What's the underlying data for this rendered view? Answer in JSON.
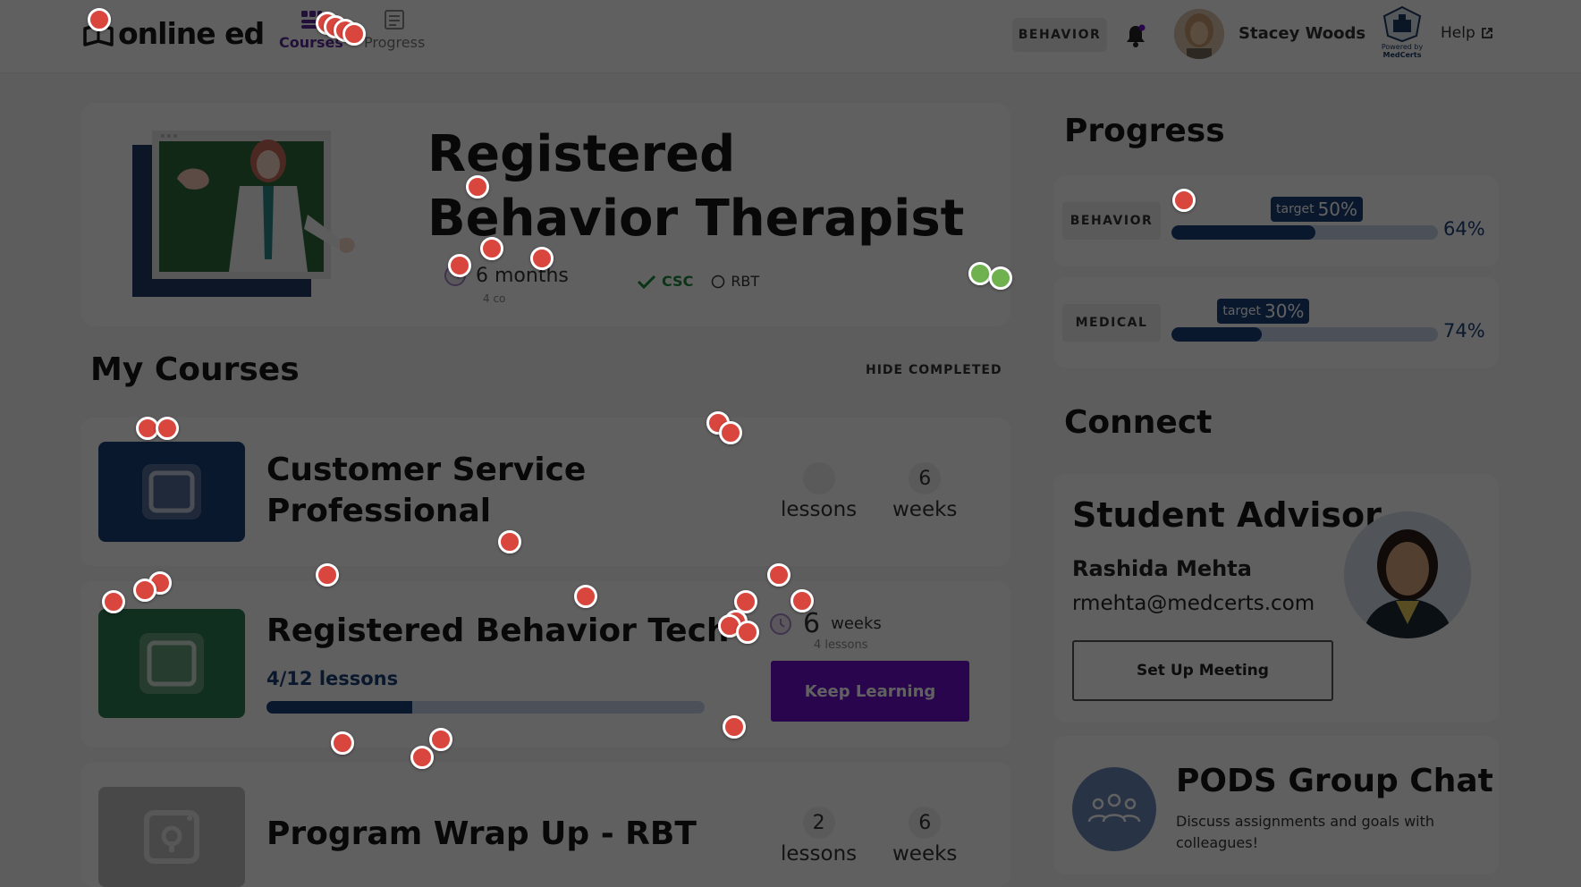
{
  "header": {
    "logo_text": "online ed",
    "nav": [
      {
        "label": "Courses",
        "icon": "courses-icon"
      },
      {
        "label": "Progress",
        "icon": "progress-icon"
      }
    ],
    "program_pill": "BEHAVIOR",
    "user_name": "Stacey Woods",
    "medcerts_line1": "Powered by",
    "medcerts_line2": "MedCerts",
    "help_label": "Help"
  },
  "hero": {
    "title": "Registered Behavior Therapist",
    "duration": "6 months",
    "duration_sub": "4 co",
    "tags": [
      {
        "label": "CSC",
        "state": "done"
      },
      {
        "label": "RBT",
        "state": "pending"
      }
    ]
  },
  "my_courses": {
    "title": "My Courses",
    "hide_completed": "HIDE COMPLETED",
    "courses": [
      {
        "title_line1": "Customer Service",
        "title_line2": "Professional",
        "lessons_num": "",
        "lessons_label": "lessons",
        "weeks_num": "6",
        "weeks_label": "weeks",
        "thumb_color": "#1c3f79"
      },
      {
        "title": "Registered Behavior Tech",
        "progress_text": "4/12 lessons",
        "progress_fraction": 0.3333,
        "duration_num": "6",
        "duration_unit": "weeks",
        "duration_sub": "4 lessons",
        "button_label": "Keep Learning",
        "thumb_color": "#2e7d4f"
      },
      {
        "title": "Program Wrap Up - RBT",
        "lessons_num": "2",
        "lessons_label": "lessons",
        "weeks_num": "6",
        "weeks_label": "weeks",
        "thumb_color": "#bbbbbb"
      }
    ]
  },
  "progress": {
    "title": "Progress",
    "items": [
      {
        "label": "BEHAVIOR",
        "target_label": "target",
        "target_value": "50%",
        "target_fraction": 0.5,
        "value_fraction": 0.64,
        "percent_text": "64%"
      },
      {
        "label": "MEDICAL",
        "target_label": "target",
        "target_value": "30%",
        "target_fraction": 0.3,
        "value_fraction": 0.74,
        "percent_text": "74%"
      }
    ]
  },
  "connect": {
    "title": "Connect",
    "advisor": {
      "title": "Student Advisor",
      "name": "Rashida Mehta",
      "email": "rmehta@medcerts.com",
      "button_label": "Set Up Meeting"
    },
    "pods": {
      "title": "PODS Group Chat",
      "description": "Discuss assignments and goals with colleagues!"
    }
  },
  "colors": {
    "accent_purple": "#6a0fc7",
    "brand_navy": "#1c3f79",
    "check_green": "#1b8a3a"
  }
}
